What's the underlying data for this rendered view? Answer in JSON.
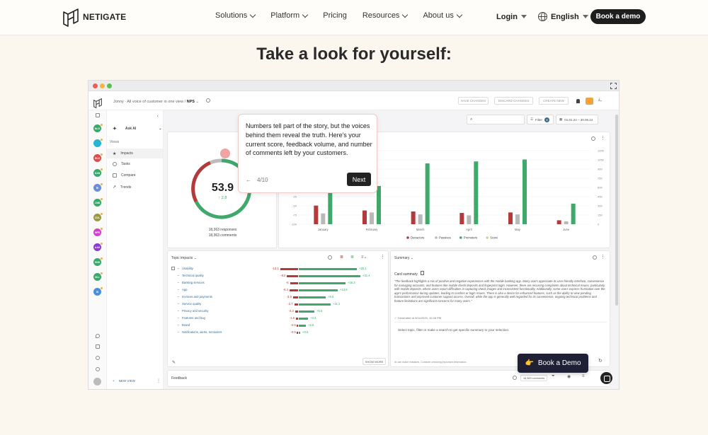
{
  "brand": {
    "name": "NETIGATE"
  },
  "nav": {
    "items": [
      {
        "label": "Solutions",
        "has_chevron": true
      },
      {
        "label": "Platform",
        "has_chevron": true
      },
      {
        "label": "Pricing",
        "has_chevron": false
      },
      {
        "label": "Resources",
        "has_chevron": true
      },
      {
        "label": "About us",
        "has_chevron": true
      }
    ],
    "login": "Login",
    "language": "English",
    "cta": "Book a demo"
  },
  "hero": {
    "title": "Take a look for yourself:"
  },
  "app": {
    "breadcrumb_prefix": "Jonny · All voice of customer in one view /",
    "breadcrumb_current": "NPS",
    "header_buttons": [
      "SAVE CHANGES",
      "DISCARD CHANGES",
      "CREATE NEW"
    ],
    "date_range": "01.01.24 – 30.06.24",
    "filter_label": "Filter",
    "filter_count": "4",
    "sidebar": {
      "ask_ai": "Ask AI",
      "views_label": "Views",
      "items": [
        "Impacts",
        "Tasks",
        "Compare",
        "Trends"
      ],
      "new_view": "NEW VIEW"
    },
    "rail_avatars": [
      {
        "initials": "NLG",
        "color": "#3aa86b"
      },
      {
        "initials": "",
        "color": "#29b5d0"
      },
      {
        "initials": "RLS",
        "color": "#e04b4b"
      },
      {
        "initials": "KAN",
        "color": "#3aa86b"
      },
      {
        "initials": "RI",
        "color": "#6c8fd4"
      },
      {
        "initials": "LNB",
        "color": "#3aa86b"
      },
      {
        "initials": "CDL",
        "color": "#9a9a40"
      },
      {
        "initials": "HFR",
        "color": "#d042c8"
      },
      {
        "initials": "AAS",
        "color": "#8a3cd0"
      },
      {
        "initials": "SNS",
        "color": "#3aa86b"
      },
      {
        "initials": "NLL",
        "color": "#3aa86b"
      },
      {
        "initials": "IS",
        "color": "#4a90d9"
      }
    ],
    "score": {
      "value": "53.9",
      "delta": "↑ 2.8",
      "responses": "18,363 responses",
      "comments": "18,363 comments"
    },
    "tooltip": {
      "text": "Numbers tell part of the story, but the voices behind them reveal the truth. Here's your current score, feedback volume, and number of comments left by your customers.",
      "step": "4/10",
      "next": "Next"
    },
    "topic_impacts": {
      "title": "Topic impacts",
      "rows": [
        {
          "name": "Usability",
          "neg": "-13.1",
          "pos": "+20.1",
          "neg_w": 0.42,
          "pos_w": 0.82
        },
        {
          "name": "Technical quality",
          "neg": "-8.2",
          "pos": "+21.4",
          "neg_w": 0.26,
          "pos_w": 0.87
        },
        {
          "name": "Banking services",
          "neg": "-6",
          "pos": "+16.3",
          "neg_w": 0.19,
          "pos_w": 0.66
        },
        {
          "name": "App",
          "neg": "-6.4",
          "pos": "+13.6",
          "neg_w": 0.2,
          "pos_w": 0.55
        },
        {
          "name": "Invoices and payments",
          "neg": "-3.9",
          "pos": "+9.5",
          "neg_w": 0.12,
          "pos_w": 0.38
        },
        {
          "name": "Service quality",
          "neg": "-2.7",
          "pos": "+11.1",
          "neg_w": 0.09,
          "pos_w": 0.45
        },
        {
          "name": "Privacy and security",
          "neg": "-2.2",
          "pos": "+5.5",
          "neg_w": 0.07,
          "pos_w": 0.22
        },
        {
          "name": "Features and bug",
          "neg": "-1.6",
          "pos": "+3.3",
          "neg_w": 0.05,
          "pos_w": 0.13
        },
        {
          "name": "Brand",
          "neg": "-0.6",
          "pos": "+2.5",
          "neg_w": 0.02,
          "pos_w": 0.1
        },
        {
          "name": "Notifications, alerts, reminders",
          "neg": "-0.5",
          "pos": "+0.5",
          "neg_w": 0.02,
          "pos_w": 0.02
        }
      ],
      "show_more": "SHOW MORE"
    },
    "summary": {
      "title": "Summary",
      "card_title": "Card summary",
      "body": "\"The feedback highlights a mix of positive and negative experiences with the mobile banking app. Many users appreciate its user-friendly interface, convenience for managing accounts, and features like mobile check deposits and fingerprint login. However, there are recurring complaints about technical issues, particularly with mobile deposits, where users report difficulties in capturing check images and inconsistent functionality. Additionally, some users express frustration over the app's performance during updates, leading to crashes or login issues. There is also a desire for enhanced features, such as the ability to view pending transactions and improved customer support access. Overall, while the app is generally well-regarded for its convenience, ongoing technical problems and feature limitations are significant concerns for many users.\"",
      "generated": "Generated at 3/24/2025, 12:08 PM",
      "prompt": "Select topic, filter or make a search to get specific summary to your selection.",
      "disclaimer": "AI can make mistakes. Consider checking important information."
    },
    "feedback": {
      "title": "Feedback",
      "count": "18,363 comments"
    }
  },
  "chart_data": {
    "type": "bar",
    "categories": [
      "January",
      "February",
      "March",
      "April",
      "May",
      "June"
    ],
    "series": [
      {
        "name": "Detractors",
        "color": "#b23a3a",
        "values": [
          38,
          28,
          26,
          23,
          24,
          8
        ]
      },
      {
        "name": "Passives",
        "color": "#b9b9b9",
        "values": [
          22,
          24,
          20,
          18,
          20,
          6
        ]
      },
      {
        "name": "Promoters",
        "color": "#3fa86a",
        "values": [
          130,
          78,
          124,
          128,
          132,
          42
        ]
      },
      {
        "name": "Score",
        "color": "#d6cf8e",
        "values": []
      }
    ],
    "y_left_ticks": [
      "-100",
      "-75",
      "-50",
      "-25",
      "0",
      "25",
      "50",
      "75",
      "100"
    ],
    "y_right_ticks": [
      "0",
      "150",
      "300",
      "450",
      "600",
      "750",
      "900",
      "1050",
      "1200"
    ],
    "ylim": [
      0,
      150
    ],
    "legend": "bottom"
  },
  "floating": {
    "book_demo": "Book a Demo",
    "hand": "👉"
  }
}
